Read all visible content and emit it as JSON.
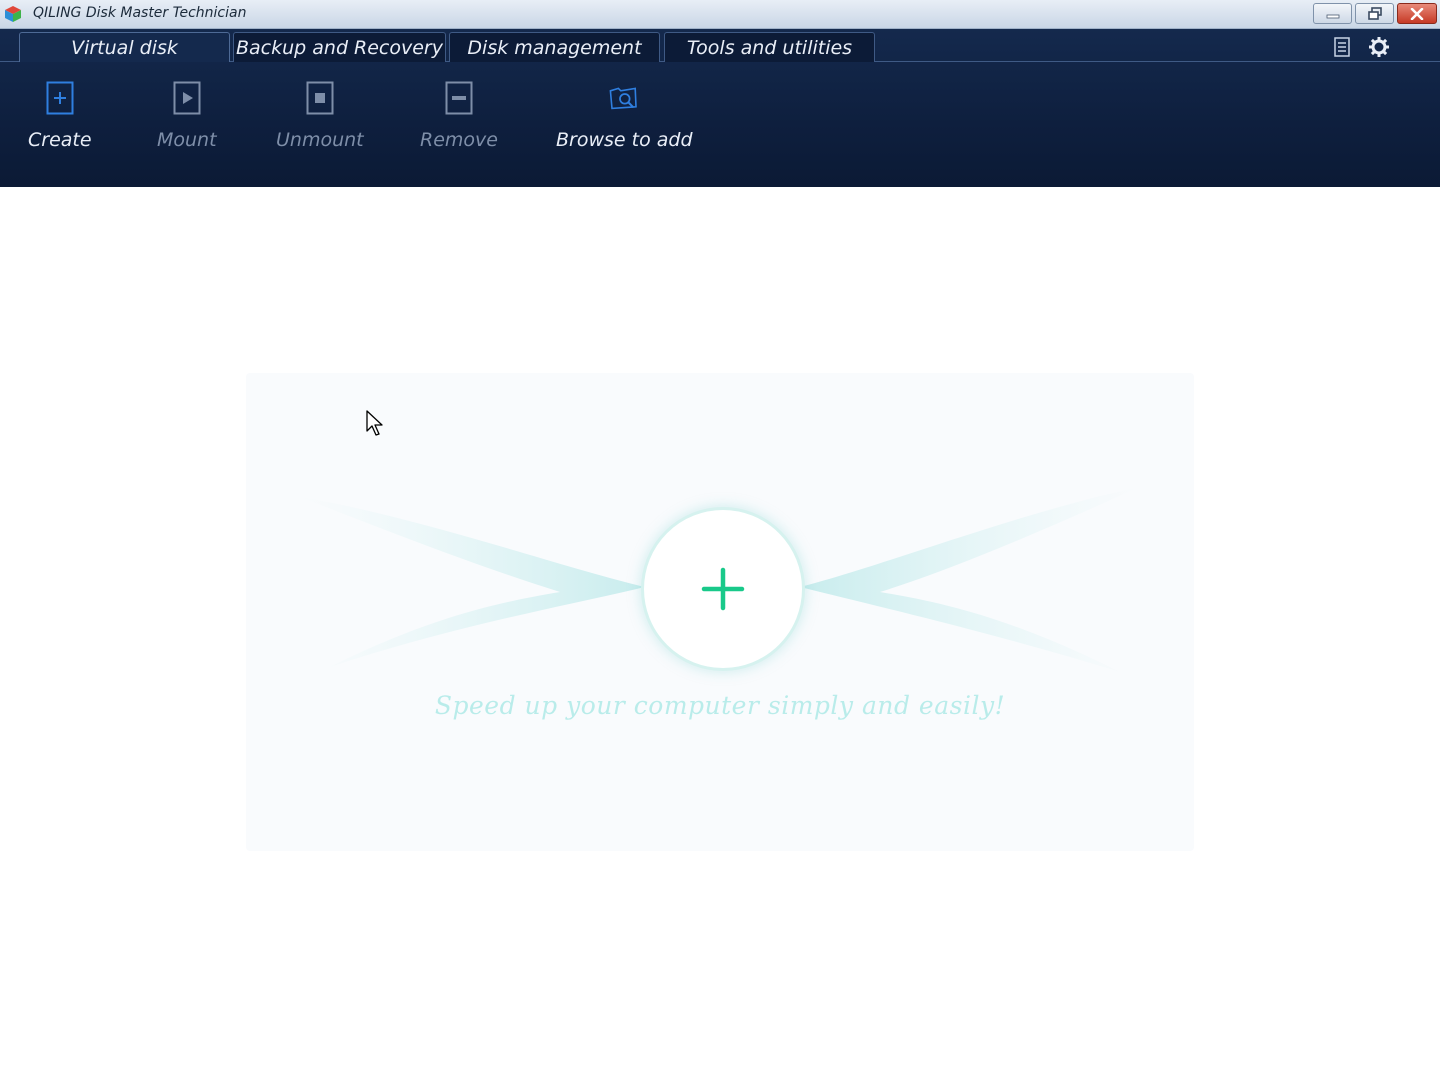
{
  "window": {
    "title": "QILING Disk Master Technician"
  },
  "tabs": [
    {
      "label": "Virtual disk",
      "active": true
    },
    {
      "label": "Backup and Recovery",
      "active": false
    },
    {
      "label": "Disk management",
      "active": false
    },
    {
      "label": "Tools and utilities",
      "active": false
    }
  ],
  "toolbar": {
    "create": "Create",
    "mount": "Mount",
    "unmount": "Unmount",
    "remove": "Remove",
    "browse_to_add": "Browse to add"
  },
  "main": {
    "slogan": "Speed up your computer simply and easily!"
  },
  "colors": {
    "ribbon": "#0e1f3e",
    "accent_plus": "#19c98a",
    "icon_blue": "#2f7fe0"
  }
}
